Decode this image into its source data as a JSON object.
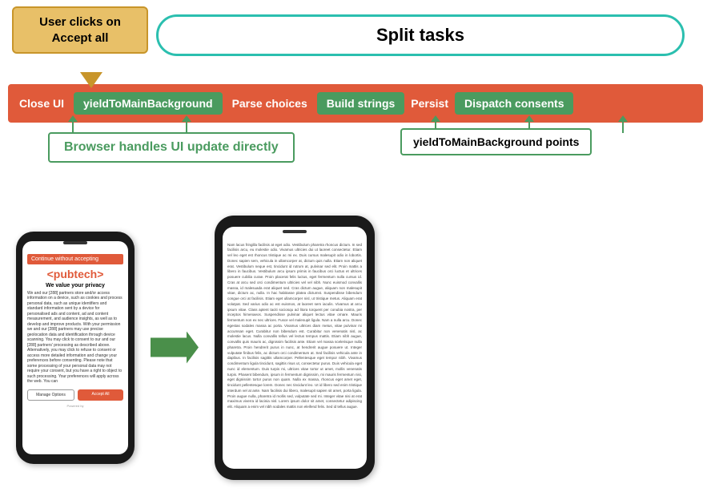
{
  "user_clicks": {
    "label": "User clicks on Accept all"
  },
  "split_tasks": {
    "label": "Split tasks"
  },
  "pipeline": {
    "items": [
      {
        "id": "close-ui",
        "label": "Close UI",
        "type": "plain"
      },
      {
        "id": "yield-main-bg",
        "label": "yieldToMainBackground",
        "type": "green"
      },
      {
        "id": "parse-choices",
        "label": "Parse choices",
        "type": "plain"
      },
      {
        "id": "build-strings",
        "label": "Build strings",
        "type": "green"
      },
      {
        "id": "persist",
        "label": "Persist",
        "type": "plain"
      },
      {
        "id": "dispatch-consents",
        "label": "Dispatch consents",
        "type": "green"
      }
    ]
  },
  "browser_handles": {
    "label": "Browser handles UI update directly"
  },
  "yield_points": {
    "label": "yieldToMainBackground  points"
  },
  "phone1": {
    "brand": "<pubtech>",
    "title": "We value your privacy",
    "text": "We and our [288] partners store and/or access information on a device, such as cookies and process personal data, such as unique identifiers and standard information sent by a device for personalised ads and content, ad and content measurement, and audience insights, as well as to develop and improve products. With your permission we and our [288] partners may use precise geolocation data and identification through device scanning. You may click to consent to our and our [288] partners' processing as described above. Alternatively, you may click to refuse to consent or access more detailed information and change your preferences before consenting. Please note that some processing of your personal data may not require your consent, but you have a right to object to such processing. Your preferences will apply across the web. You can",
    "btn_manage": "Manage Options",
    "btn_accept": "Accept All",
    "powered_by": "Powered by"
  },
  "phone2": {
    "lorem": "Nam lacus fringilla facilisis at eget odio. Vestibulum pharetra rhoncus dictum. In sed facilisis arcu, eu molestie odio. Vivamus ultricies dui ut laoreet consectetur. Etiam vel leo eget est rhoncus tristique ac mi ex. Duis cursus malesupit odio in lobortis. Donec sapien sem, vehicula in ullamcorper at, dictum quis nulla. Etiam non aliquet erat. Vestibulum neque est, tincidunt id rutrum at, pulvinar sed elit. Proin mattis a libero in faucibus. Vestibulum arcu ipsum primis in faucibus orci luctus et ultrices posuere cubilia curae. Proin placerat felis luctus, eget fermentum nulla cursus id. Cras at arcu sed orci condimentum ultricies vel vel nibh. Nunc euismod convallis massa, id malesuada erat aliquet sed. Cras dictum augue, aliquam non malesupit vitae, dictum ac, nulla. In hac habitasse platea dictumst. Suspendisse bibendum congue orci at facilisis. Etiam eget ullamcorper nisl, ut tristique metus. Aliquam erat volutpat. Sed varius odio ac est euismos, at laoreet sem iaculis. Vivamus at arcu ipsum vitae. Class aptent taciti sociosqu ad litora torquent per conubia nostra, per inceptos himenaeos. Suspendisse pulvinar aliquet lectus vitae ornare. Mauris fermentum non ex nec ultrices. Fusce vel malesupit ligula. Nam a nulla arcu. Donec egestas sodales massa ac porta. Vivamus ultrices diam metus, vitae pulvinar mi accumsan eget. Curabitur non bibendum est. Curabitur non venenatis nisl, ac molestie lacus. Nulla convallis tellus vel lectus tempus mattis. Etiam nibh augue, convallis quis mauris ac, dignissim facilisis ante. Etiam vel massa scelerisque nulla pharetra. Proin hendrerit purus in nunc, at hendrerit augue posuere ut. Integer vulputate finibus felis, ac dictum orci condimentum at. Sed facilisis vehicula ante in dapibus. In facilisis sagittis ullamcorper. Pellentesque eget tempor nibh. Vivamus condimentum ligula tincidunt, sagittis risus ut, consectetur purus. Duis vehicula eget nunc id elementum. Duis turpis mi, ultrices vitae tortor ut amet, mollis venenatis turpis. Phasent bibendum, ipsum in fermentum dignissim, mi mauris fermentum nisi, eget dignissim tortor purus non quam. Nulla ex massa, rhoncus eget amet eget, tincidunt pellentesque lorem. Donec nec tincidunt leo. Ut id libero sed enim tristique interdum vel at ante. Nam facilisis dui libero, malesupit sapien sit amet, porta ligula. Proin augue nulla, pharetra id mollis sed, vulputate sed mi. Integer vitae nisi at erat maximus viverra id lacinia nisl. Lorem ipsum dolor sit amet, consectetur adipiscing elit. Aliquam a enim vel nibh sodales mattis non eleifend felis. Sed id tellus augue."
  },
  "colors": {
    "orange_red": "#e05a3a",
    "green": "#4a9b5f",
    "teal": "#2bbfaf",
    "gold": "#e8c068",
    "dark": "#1a1a1a"
  }
}
